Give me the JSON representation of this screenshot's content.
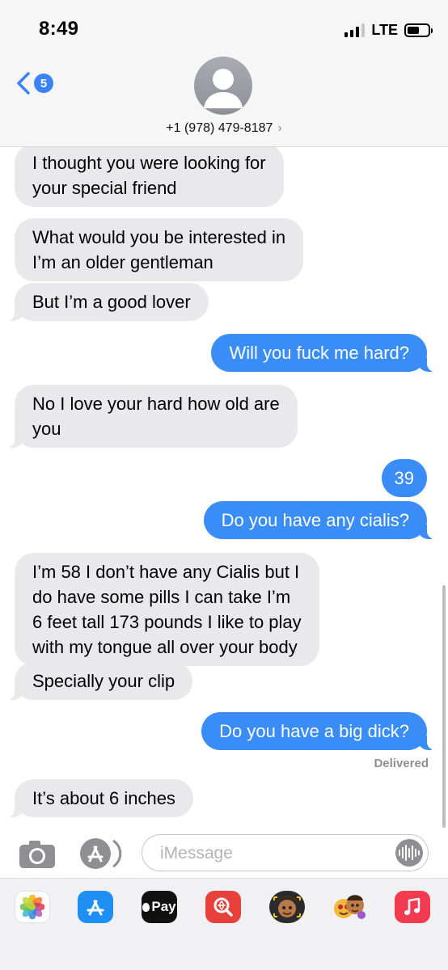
{
  "status_bar": {
    "time": "8:49",
    "network": "LTE"
  },
  "header": {
    "back_badge": "5",
    "contact_number": "+1 (978) 479-8187",
    "chevron": "›"
  },
  "messages": [
    {
      "direction": "received",
      "lines": [
        "I thought you were looking for",
        "your special friend"
      ]
    },
    {
      "direction": "received",
      "lines": [
        "What would you be interested in",
        "I’m an older gentleman"
      ]
    },
    {
      "direction": "received",
      "lines": [
        "But I’m a good lover"
      ]
    },
    {
      "direction": "sent",
      "lines": [
        "Will you fuck me hard?"
      ]
    },
    {
      "direction": "received",
      "lines": [
        "No I love your hard how old are",
        "you"
      ]
    },
    {
      "direction": "sent",
      "lines": [
        "39"
      ]
    },
    {
      "direction": "sent",
      "lines": [
        "Do you have any cialis?"
      ]
    },
    {
      "direction": "received",
      "lines": [
        "I’m 58 I don’t have any Cialis but I",
        "do have some pills I can take I’m",
        "6 feet tall 173 pounds I like to play",
        "with my tongue all over your body"
      ]
    },
    {
      "direction": "received",
      "lines": [
        "Specially your clip"
      ]
    },
    {
      "direction": "sent",
      "lines": [
        "Do you have a big dick?"
      ]
    },
    {
      "direction": "received",
      "lines": [
        "It’s about 6 inches"
      ]
    }
  ],
  "delivered_label": "Delivered",
  "input": {
    "placeholder": "iMessage"
  },
  "app_drawer": {
    "apple_pay_label": "Pay",
    "apps": [
      "photos-icon",
      "app-store-icon",
      "apple-pay-icon",
      "web-search-icon",
      "memoji-icon",
      "memoji-stickers-icon",
      "music-icon"
    ]
  },
  "colors": {
    "sent_bubble": "#3a8cf6",
    "received_bubble": "#e9e9eb",
    "accent": "#3a82f6"
  }
}
